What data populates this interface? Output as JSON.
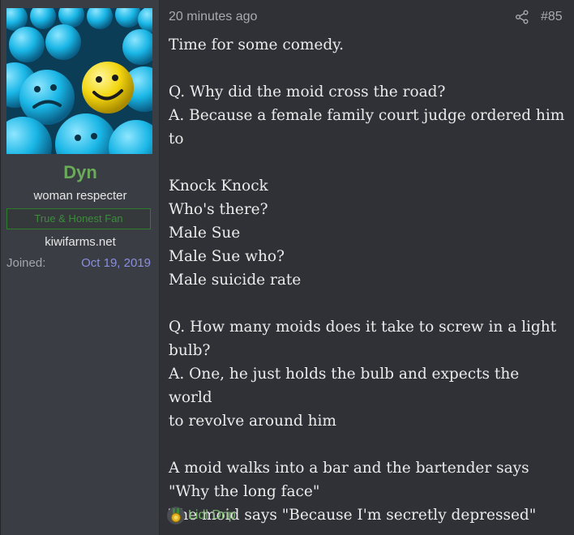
{
  "user": {
    "name": "Dyn",
    "title": "woman respecter",
    "banner": "True & Honest Fan",
    "site": "kiwifarms.net",
    "joined_label": "Joined:",
    "joined_value": "Oct 19, 2019"
  },
  "post": {
    "timestamp": "20 minutes ago",
    "number": "#85",
    "lines": [
      "Time for some comedy.",
      "",
      "Q. Why did the moid cross the road?",
      "A. Because a female family court judge ordered him",
      "to",
      "",
      "Knock Knock",
      "Who's there?",
      "Male Sue",
      "Male Sue who?",
      "Male suicide rate",
      "",
      "Q. How many moids does it take to screw in a light",
      "bulb?",
      "A. One, he just holds the bulb and expects the world",
      "to revolve around him",
      "",
      "A moid walks into a bar and the bartender says",
      "\"Why the long face\"",
      "The moid says \"Because I'm secretly depressed\""
    ]
  },
  "reaction": {
    "label": "Lidl Drip",
    "icon": "medal-icon"
  },
  "icons": {
    "share": "share-icon"
  },
  "colors": {
    "username": "#6aab5a",
    "joined_date": "#8a8fe0",
    "banner_border": "#2d7d2d",
    "reaction_label": "#7ab86a"
  }
}
